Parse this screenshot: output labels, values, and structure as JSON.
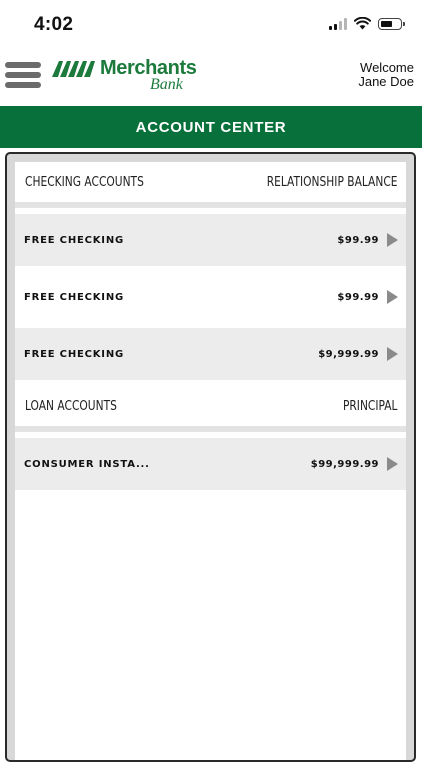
{
  "status_bar": {
    "time": "4:02"
  },
  "header": {
    "logo_name": "Merchants",
    "logo_sub": "Bank",
    "welcome_line1": "Welcome",
    "welcome_line2": "Jane Doe"
  },
  "title": "ACCOUNT CENTER",
  "checking": {
    "header_left": "CHECKING ACCOUNTS",
    "header_right": "RELATIONSHIP BALANCE",
    "accounts": [
      {
        "name": "FREE CHECKING",
        "amount": "$99.99"
      },
      {
        "name": "FREE CHECKING",
        "amount": "$99.99"
      },
      {
        "name": "FREE CHECKING",
        "amount": "$9,999.99"
      }
    ]
  },
  "loans": {
    "header_left": "LOAN ACCOUNTS",
    "header_right": "PRINCIPAL",
    "accounts": [
      {
        "name": "CONSUMER INSTA...",
        "amount": "$99,999.99"
      }
    ]
  },
  "colors": {
    "brand_green": "#08703a",
    "logo_green": "#1c7a3c"
  },
  "icons": {
    "menu": "hamburger-menu-icon",
    "row_arrow": "chevron-right-icon",
    "wifi": "wifi-icon",
    "battery": "battery-icon",
    "signal": "cellular-signal-icon"
  }
}
